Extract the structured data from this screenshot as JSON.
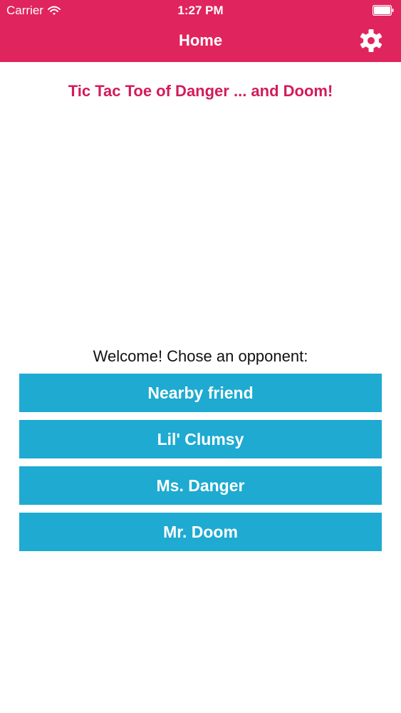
{
  "status_bar": {
    "carrier": "Carrier",
    "time": "1:27 PM"
  },
  "nav": {
    "title": "Home"
  },
  "app_title": "Tic Tac Toe of Danger ... and Doom!",
  "prompt": "Welcome! Chose an opponent:",
  "opponents": [
    {
      "label": "Nearby friend"
    },
    {
      "label": "Lil' Clumsy"
    },
    {
      "label": "Ms. Danger"
    },
    {
      "label": "Mr. Doom"
    }
  ],
  "colors": {
    "header": "#e0245e",
    "title": "#d41b5a",
    "button": "#1eaad1"
  },
  "icons": {
    "wifi": "wifi-icon",
    "battery": "battery-icon",
    "settings": "gear-icon"
  }
}
